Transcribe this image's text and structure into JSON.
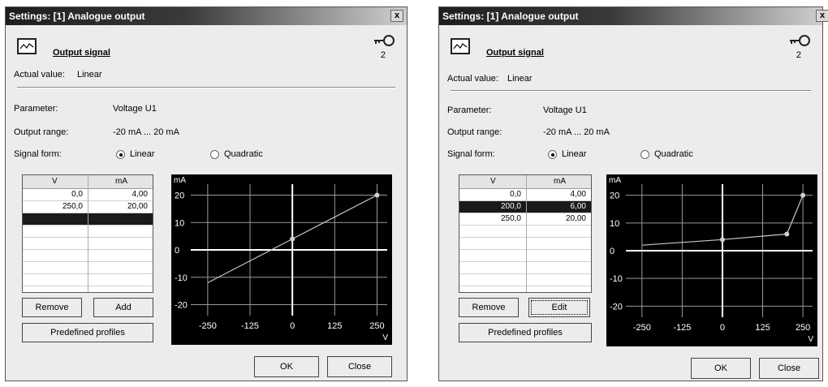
{
  "dialogs": [
    {
      "title": "Settings: [1] Analogue output",
      "close_label": "x",
      "section_title": "Output signal",
      "access_level": "2",
      "actual_value_label": "Actual value:",
      "actual_value": "Linear",
      "parameter_label": "Parameter:",
      "parameter_value": "Voltage U1",
      "output_range_label": "Output range:",
      "output_range_value": "-20 mA ... 20 mA",
      "signal_form_label": "Signal form:",
      "signal_form_options": [
        "Linear",
        "Quadratic"
      ],
      "signal_form_selected": "Linear",
      "table": {
        "columns": [
          "V",
          "mA"
        ],
        "rows": [
          {
            "v": "0,0",
            "ma": "4,00",
            "selected": false
          },
          {
            "v": "250,0",
            "ma": "20,00",
            "selected": false
          },
          {
            "v": "",
            "ma": "",
            "selected": true
          }
        ]
      },
      "buttons": {
        "remove": "Remove",
        "add_edit": "Add",
        "profiles": "Predefined profiles",
        "ok": "OK",
        "close": "Close"
      },
      "chart_data": {
        "type": "line",
        "title": "",
        "xlabel": "V",
        "ylabel": "mA",
        "xlim": [
          -300,
          280
        ],
        "ylim": [
          -24,
          24
        ],
        "x_ticks": [
          -250,
          -125,
          0,
          125,
          250
        ],
        "y_ticks": [
          20,
          10,
          0,
          -10,
          -20
        ],
        "x_tick_labels": [
          "-250",
          "-125",
          "0",
          "125",
          "250"
        ],
        "y_tick_labels": [
          "20",
          "10",
          "0",
          "-10",
          "-20"
        ],
        "grid": true,
        "series": [
          {
            "x": [
              -250,
              0,
              250
            ],
            "y": [
              -12,
              4,
              20
            ],
            "markers": [
              false,
              true,
              true
            ]
          }
        ],
        "colors": {
          "background": "#000000",
          "grid": "#9a9a9a",
          "axis": "#ffffff",
          "line": "#c8c8c8",
          "marker": "#d0d0d0"
        }
      }
    },
    {
      "title": "Settings: [1] Analogue output",
      "close_label": "x",
      "section_title": "Output signal",
      "access_level": "2",
      "actual_value_label": "Actual value:",
      "actual_value": "Linear",
      "parameter_label": "Parameter:",
      "parameter_value": "Voltage U1",
      "output_range_label": "Output range:",
      "output_range_value": "-20 mA ... 20 mA",
      "signal_form_label": "Signal form:",
      "signal_form_options": [
        "Linear",
        "Quadratic"
      ],
      "signal_form_selected": "Linear",
      "table": {
        "columns": [
          "V",
          "mA"
        ],
        "rows": [
          {
            "v": "0,0",
            "ma": "4,00",
            "selected": false
          },
          {
            "v": "200,0",
            "ma": "6,00",
            "selected": true
          },
          {
            "v": "250,0",
            "ma": "20,00",
            "selected": false
          }
        ]
      },
      "buttons": {
        "remove": "Remove",
        "add_edit": "Edit",
        "profiles": "Predefined profiles",
        "ok": "OK",
        "close": "Close"
      },
      "chart_data": {
        "type": "line",
        "title": "",
        "xlabel": "V",
        "ylabel": "mA",
        "xlim": [
          -300,
          280
        ],
        "ylim": [
          -24,
          24
        ],
        "x_ticks": [
          -250,
          -125,
          0,
          125,
          250
        ],
        "y_ticks": [
          20,
          10,
          0,
          -10,
          -20
        ],
        "x_tick_labels": [
          "-250",
          "-125",
          "0",
          "125",
          "250"
        ],
        "y_tick_labels": [
          "20",
          "10",
          "0",
          "-10",
          "-20"
        ],
        "grid": true,
        "series": [
          {
            "x": [
              -250,
              0,
              200,
              250
            ],
            "y": [
              2,
              4,
              6,
              20
            ],
            "markers": [
              false,
              true,
              true,
              true
            ]
          }
        ],
        "colors": {
          "background": "#000000",
          "grid": "#9a9a9a",
          "axis": "#ffffff",
          "line": "#c8c8c8",
          "marker": "#d0d0d0"
        }
      }
    }
  ]
}
